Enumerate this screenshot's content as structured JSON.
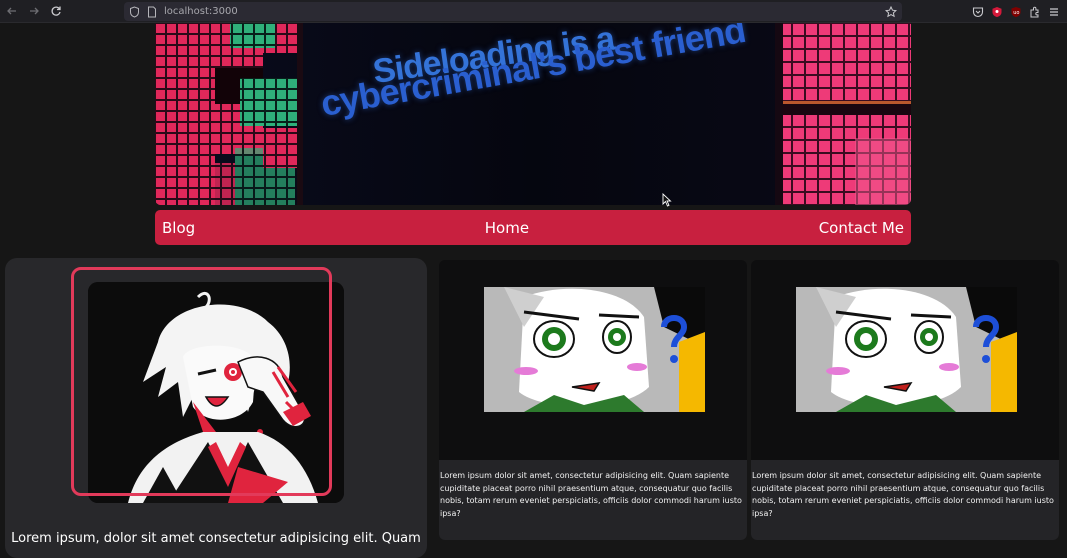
{
  "browser": {
    "url": "localhost:3000",
    "icons": [
      "back-icon",
      "forward-icon",
      "reload-icon",
      "shield-icon",
      "page-icon",
      "star-icon",
      "pocket-icon",
      "extension-red-icon",
      "ublock-icon",
      "extensions-icon",
      "menu-icon"
    ]
  },
  "hero": {
    "line1": "Sideloading is a",
    "line2": "cybercriminal's best friend"
  },
  "nav": {
    "blog": "Blog",
    "home": "Home",
    "contact": "Contact Me"
  },
  "profile": {
    "bio": "Lorem ipsum, dolor sit amet consectetur adipisicing elit. Quam"
  },
  "posts": [
    {
      "excerpt": "Lorem ipsum dolor sit amet, consectetur adipisicing elit. Quam sapiente cupiditate placeat porro nihil praesentium atque, consequatur quo facilis nobis, totam rerum eveniet perspiciatis, officiis dolor commodi harum iusto ipsa?"
    },
    {
      "excerpt": "Lorem ipsum dolor sit amet, consectetur adipisicing elit. Quam sapiente cupiditate placeat porro nihil praesentium atque, consequatur quo facilis nobis, totam rerum eveniet perspiciatis, officiis dolor commodi harum iusto ipsa?"
    }
  ],
  "colors": {
    "page_bg": "#161616",
    "nav_accent": "#c8203f",
    "frame_accent": "#e23a5a",
    "card_bg": "#28282b",
    "post_bg": "#0e0e0f",
    "post_text_bg": "#242427",
    "headline_blue": "#2d6fd6"
  }
}
